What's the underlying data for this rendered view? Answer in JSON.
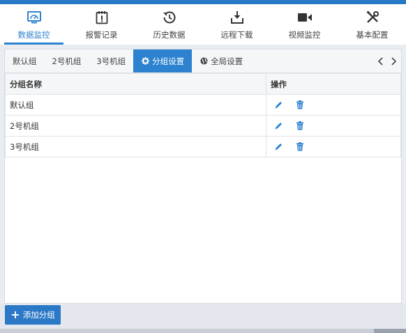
{
  "nav": {
    "items": [
      {
        "label": "数据监控",
        "icon": "dashboard-monitor-icon"
      },
      {
        "label": "报警记录",
        "icon": "alarm-calendar-icon"
      },
      {
        "label": "历史数据",
        "icon": "history-clock-icon"
      },
      {
        "label": "远程下载",
        "icon": "download-icon"
      },
      {
        "label": "视频监控",
        "icon": "video-camera-icon"
      },
      {
        "label": "基本配置",
        "icon": "tools-icon"
      }
    ],
    "active_index": 0
  },
  "tabs": {
    "items": [
      {
        "label": "默认组"
      },
      {
        "label": "2号机组"
      },
      {
        "label": "3号机组"
      },
      {
        "label": "分组设置",
        "icon": "gear-icon"
      },
      {
        "label": "全局设置",
        "icon": "globe-icon"
      }
    ],
    "active_index": 3
  },
  "table": {
    "headers": {
      "name": "分组名称",
      "ops": "操作"
    },
    "rows": [
      {
        "name": "默认组"
      },
      {
        "name": "2号机组"
      },
      {
        "name": "3号机组"
      }
    ]
  },
  "footer": {
    "add_button_label": "添加分组"
  },
  "colors": {
    "accent": "#2d82d0",
    "button": "#2b78c6",
    "topbar": "#2878c8"
  }
}
